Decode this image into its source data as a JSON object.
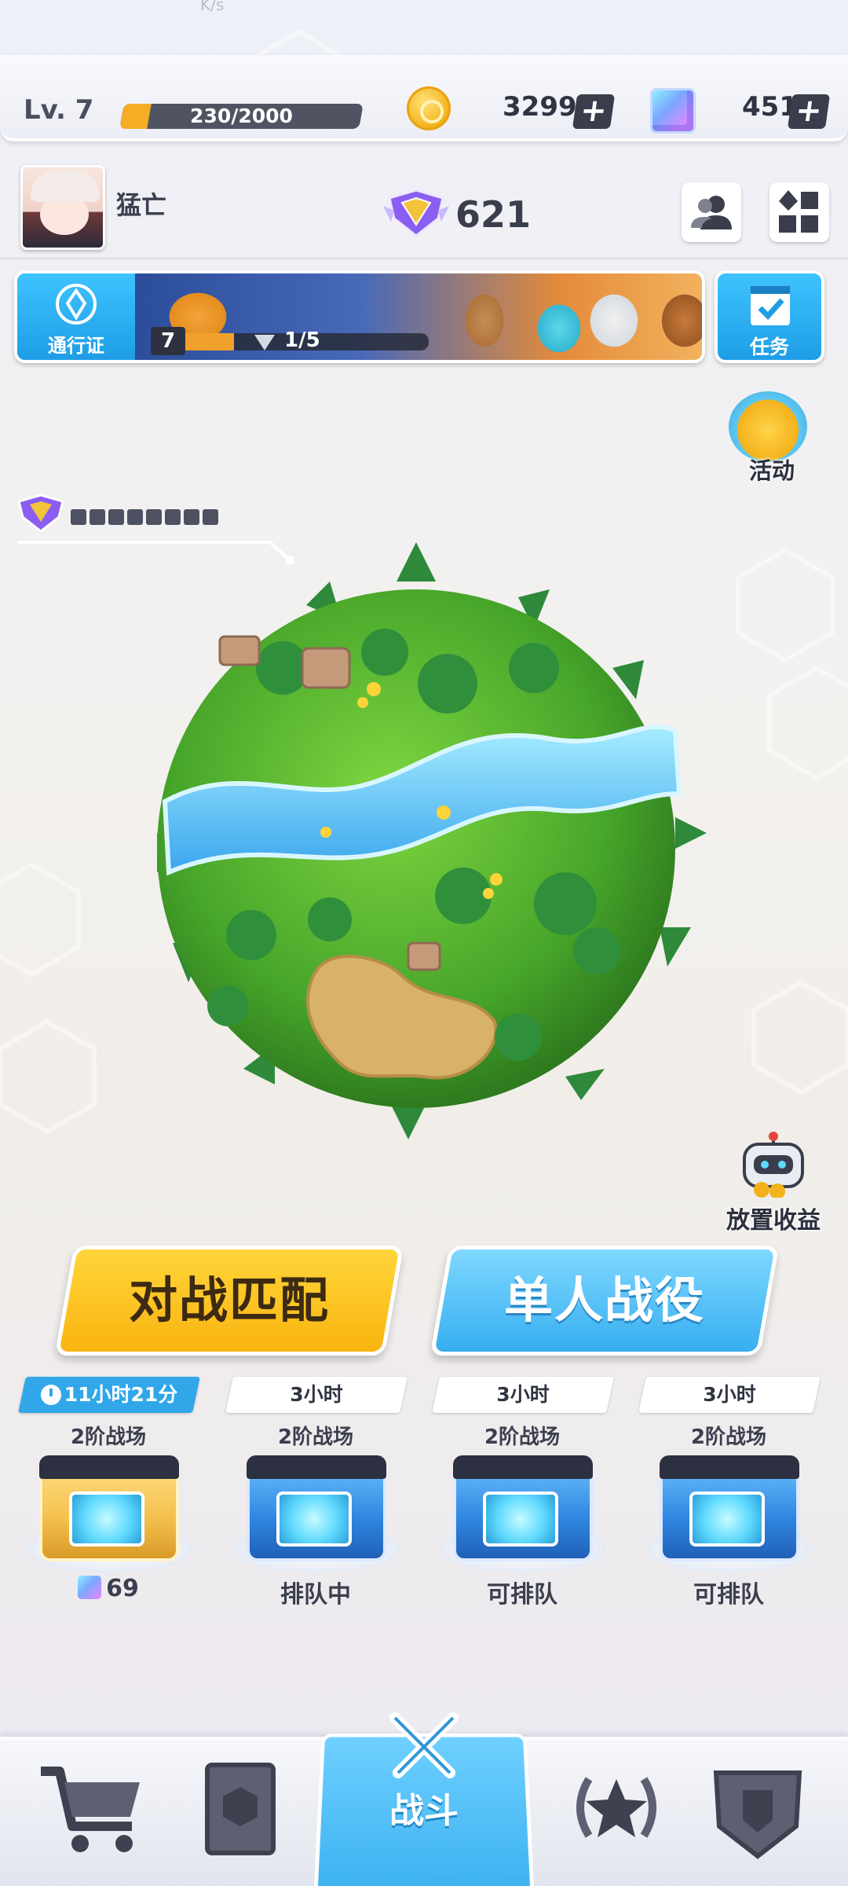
{
  "status_bar": {
    "net_speed": "K/s"
  },
  "resources": {
    "level_label": "Lv. 7",
    "xp_text": "230/2000",
    "xp_fraction": 0.115,
    "coins": "3299",
    "gems": "451",
    "add_label": "+"
  },
  "profile": {
    "name": "猛亡",
    "rank_points": "621"
  },
  "battle_pass": {
    "label": "通行证",
    "level": "7",
    "progress_text": "1/5",
    "progress_fraction": 0.2
  },
  "tasks": {
    "label": "任务"
  },
  "event": {
    "label": "活动"
  },
  "idle_income": {
    "label": "放置收益"
  },
  "rank_progress": {
    "segments": 8,
    "filled": 0
  },
  "main_buttons": {
    "match": "对战匹配",
    "campaign": "单人战役"
  },
  "chest_slots": [
    {
      "timer": "11小时21分",
      "tier": "2阶战场",
      "status": "69",
      "type": "gold",
      "active": true
    },
    {
      "timer": "3小时",
      "tier": "2阶战场",
      "status": "排队中",
      "type": "blue",
      "active": false
    },
    {
      "timer": "3小时",
      "tier": "2阶战场",
      "status": "可排队",
      "type": "blue",
      "active": false
    },
    {
      "timer": "3小时",
      "tier": "2阶战场",
      "status": "可排队",
      "type": "blue",
      "active": false
    }
  ],
  "nav": {
    "items": [
      "shop-icon",
      "cards-icon",
      "battle-icon",
      "ranking-icon",
      "clan-icon"
    ],
    "active_label": "战斗"
  },
  "colors": {
    "accent_yellow": "#f9b40f",
    "accent_blue": "#36aef0",
    "dark": "#3a3e4c"
  }
}
